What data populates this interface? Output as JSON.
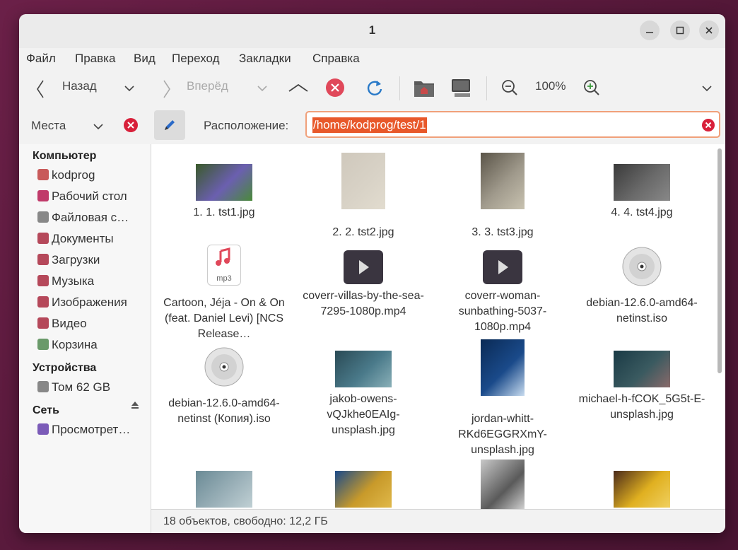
{
  "window": {
    "title": "1"
  },
  "menu": [
    "Файл",
    "Правка",
    "Вид",
    "Переход",
    "Закладки",
    "Справка"
  ],
  "toolbar": {
    "back": "Назад",
    "forward": "Вперёд",
    "zoom": "100%"
  },
  "location": {
    "places_label": "Места",
    "label": "Расположение:",
    "path": "/home/kodprog/test/1"
  },
  "sidebar": {
    "computer_header": "Компьютер",
    "computer_items": [
      {
        "label": "kodprog",
        "color": "#c85a5a"
      },
      {
        "label": "Рабочий стол",
        "color": "#c03a6a"
      },
      {
        "label": "Файловая с…",
        "color": "#888888"
      },
      {
        "label": "Документы",
        "color": "#b5485a"
      },
      {
        "label": "Загрузки",
        "color": "#b5485a"
      },
      {
        "label": "Музыка",
        "color": "#b5485a"
      },
      {
        "label": "Изображения",
        "color": "#b5485a"
      },
      {
        "label": "Видео",
        "color": "#b5485a"
      },
      {
        "label": "Корзина",
        "color": "#6a9a6a"
      }
    ],
    "devices_header": "Устройства",
    "devices_items": [
      {
        "label": "Том 62 GB",
        "color": "#888888"
      }
    ],
    "network_header": "Сеть",
    "network_items": [
      {
        "label": "Просмотрет…",
        "color": "#7b5bb8"
      }
    ]
  },
  "files": [
    {
      "name": "1. 1. tst1.jpg",
      "kind": "image",
      "colors": [
        "#3a5a2a",
        "#6b5fb0",
        "#4a8a3a"
      ]
    },
    {
      "name": "2. 2. tst2.jpg",
      "kind": "image",
      "colors": [
        "#cfc8bc",
        "#d8d2c6",
        "#e2dccf"
      ]
    },
    {
      "name": "3. 3. tst3.jpg",
      "kind": "image",
      "colors": [
        "#5a5448",
        "#a09a8c",
        "#c8c2b0"
      ]
    },
    {
      "name": "4. 4. tst4.jpg",
      "kind": "image",
      "colors": [
        "#3a3a3a",
        "#6a6a6a",
        "#888888"
      ]
    },
    {
      "name": "Cartoon, Jéja - On & On (feat. Daniel Levi) [NCS Release…",
      "kind": "mp3",
      "icon_text": "mp3"
    },
    {
      "name": "coverr-villas-by-the-sea-7295-1080p.mp4",
      "kind": "video"
    },
    {
      "name": "coverr-woman-sunbathing-5037-1080p.mp4",
      "kind": "video"
    },
    {
      "name": "debian-12.6.0-amd64-netinst.iso",
      "kind": "iso"
    },
    {
      "name": "debian-12.6.0-amd64-netinst (Копия).iso",
      "kind": "iso"
    },
    {
      "name": "jakob-owens-vQJkhe0EAIg-unsplash.jpg",
      "kind": "image",
      "colors": [
        "#2a4a55",
        "#4a7a8a",
        "#8ab0b8"
      ]
    },
    {
      "name": "jordan-whitt-RKd6EGGRXmY-unsplash.jpg",
      "kind": "image",
      "colors": [
        "#0a2a55",
        "#1a4a8a",
        "#c8dcf0"
      ]
    },
    {
      "name": "michael-h-fCOK_5G5t-E-unsplash.jpg",
      "kind": "image",
      "colors": [
        "#1a3a45",
        "#3a5a60",
        "#8a6a6a"
      ]
    },
    {
      "name": "",
      "kind": "image",
      "colors": [
        "#6a8a95",
        "#9ab0b8",
        "#c0d0d4"
      ]
    },
    {
      "name": "",
      "kind": "image",
      "colors": [
        "#1a4a8a",
        "#c89a2a",
        "#e0b84a"
      ]
    },
    {
      "name": "",
      "kind": "image",
      "colors": [
        "#c8c8c8",
        "#5a5a5a",
        "#e6e6e6"
      ]
    },
    {
      "name": "",
      "kind": "image",
      "colors": [
        "#4a2a1a",
        "#e0b020",
        "#f0d060"
      ]
    }
  ],
  "status": "18 объектов, свободно: 12,2 ГБ"
}
